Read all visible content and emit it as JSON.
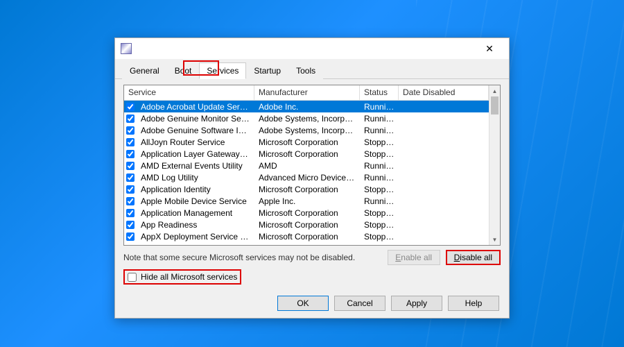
{
  "tabs": {
    "general": "General",
    "boot": "Boot",
    "services": "Services",
    "startup": "Startup",
    "tools": "Tools",
    "active": "services"
  },
  "columns": {
    "service": "Service",
    "manufacturer": "Manufacturer",
    "status": "Status",
    "date": "Date Disabled"
  },
  "rows": [
    {
      "svc": "Adobe Acrobat Update Service",
      "mfr": "Adobe Inc.",
      "status": "Running",
      "sel": true
    },
    {
      "svc": "Adobe Genuine Monitor Service",
      "mfr": "Adobe Systems, Incorpora...",
      "status": "Running"
    },
    {
      "svc": "Adobe Genuine Software Integri...",
      "mfr": "Adobe Systems, Incorpora...",
      "status": "Running"
    },
    {
      "svc": "AllJoyn Router Service",
      "mfr": "Microsoft Corporation",
      "status": "Stopped"
    },
    {
      "svc": "Application Layer Gateway Service",
      "mfr": "Microsoft Corporation",
      "status": "Stopped"
    },
    {
      "svc": "AMD External Events Utility",
      "mfr": "AMD",
      "status": "Running"
    },
    {
      "svc": "AMD Log Utility",
      "mfr": "Advanced Micro Devices, I...",
      "status": "Running"
    },
    {
      "svc": "Application Identity",
      "mfr": "Microsoft Corporation",
      "status": "Stopped"
    },
    {
      "svc": "Apple Mobile Device Service",
      "mfr": "Apple Inc.",
      "status": "Running"
    },
    {
      "svc": "Application Management",
      "mfr": "Microsoft Corporation",
      "status": "Stopped"
    },
    {
      "svc": "App Readiness",
      "mfr": "Microsoft Corporation",
      "status": "Stopped"
    },
    {
      "svc": "AppX Deployment Service (AppX...",
      "mfr": "Microsoft Corporation",
      "status": "Stopped"
    }
  ],
  "note": "Note that some secure Microsoft services may not be disabled.",
  "buttons": {
    "enable": "nable all",
    "enable_prefix": "E",
    "disable": "isable all",
    "disable_prefix": "D",
    "hide": "ide all Microsoft services",
    "hide_prefix": "H"
  },
  "footer": {
    "ok": "OK",
    "cancel": "Cancel",
    "apply": "Apply",
    "help": "Help"
  }
}
